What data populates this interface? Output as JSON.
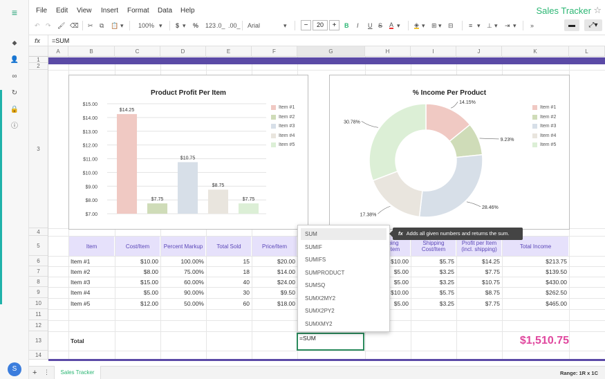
{
  "menu": [
    "File",
    "Edit",
    "View",
    "Insert",
    "Format",
    "Data",
    "Help"
  ],
  "app_title": "Sales Tracker",
  "toolbar": {
    "zoom": "100%",
    "currency": "$",
    "percent": "%",
    "more_formats": "123",
    "dec_dec": ".0_",
    "inc_dec": ".00_",
    "font": "Arial",
    "font_size": "20",
    "minus": "−",
    "plus": "+",
    "bold": "B",
    "italic": "I",
    "underline": "U",
    "strike": "S",
    "text_color": "A"
  },
  "formula_bar": {
    "fx": "fx",
    "value": "=SUM"
  },
  "columns": [
    "A",
    "B",
    "C",
    "D",
    "E",
    "F",
    "G",
    "H",
    "I",
    "J",
    "K",
    "L"
  ],
  "rows": [
    "1",
    "2",
    "3",
    "4",
    "5",
    "6",
    "7",
    "8",
    "9",
    "10",
    "11",
    "12",
    "13",
    "14"
  ],
  "table": {
    "headers": [
      "Item",
      "Cost/Item",
      "Percent Markup",
      "Total Sold",
      "Price/Item",
      "",
      "Shipping Cost/Item",
      "Shipping Cost/Item",
      "Profit per Item (incl. shipping)",
      "Total Income"
    ],
    "header_h_partial": "ping\n/Item",
    "rows": [
      [
        "Item #1",
        "$10.00",
        "100.00%",
        "15",
        "$20.00",
        "",
        "$10.00",
        "$5.75",
        "$14.25",
        "$213.75"
      ],
      [
        "Item #2",
        "$8.00",
        "75.00%",
        "18",
        "$14.00",
        "",
        "$5.00",
        "$3.25",
        "$7.75",
        "$139.50"
      ],
      [
        "Item #3",
        "$15.00",
        "60.00%",
        "40",
        "$24.00",
        "",
        "$5.00",
        "$3.25",
        "$10.75",
        "$430.00"
      ],
      [
        "Item #4",
        "$5.00",
        "90.00%",
        "30",
        "$9.50",
        "",
        "$10.00",
        "$5.75",
        "$8.75",
        "$262.50"
      ],
      [
        "Item #5",
        "$12.00",
        "50.00%",
        "60",
        "$18.00",
        "",
        "$5.00",
        "$3.25",
        "$7.75",
        "$465.00"
      ]
    ],
    "total_label": "Total",
    "total_value": "$1,510.75"
  },
  "edit_cell": "=SUM",
  "autocomplete": [
    "SUM",
    "SUMIF",
    "SUMIFS",
    "SUMPRODUCT",
    "SUMSQ",
    "SUMX2MY2",
    "SUMX2PY2",
    "SUMXMY2"
  ],
  "tooltip": {
    "fx": "fx",
    "text": "Adds all given numbers and returns the sum."
  },
  "sheet_tab": "Sales Tracker",
  "add_sheet": "+",
  "sheet_menu": "⋮",
  "range_label": "Range: 1R x 1C",
  "colors": {
    "accent": "#2bb673",
    "band": "#5b4aa6",
    "header_bg": "#e6e1fb",
    "total": "#e0479e",
    "item1": "#f0c9c3",
    "item2": "#cfdcb8",
    "item3": "#d7dfe8",
    "item4": "#e9e5de",
    "item5": "#dcefd6"
  },
  "chart_data": [
    {
      "type": "bar",
      "title": "Product Profit Per Item",
      "categories": [
        "Item #1",
        "Item #2",
        "Item #3",
        "Item #4",
        "Item #5"
      ],
      "values": [
        14.25,
        7.75,
        10.75,
        8.75,
        7.75
      ],
      "data_labels": [
        "$14.25",
        "$7.75",
        "$10.75",
        "$8.75",
        "$7.75"
      ],
      "ylim": [
        7,
        15
      ],
      "yticks": [
        "$15.00",
        "$14.00",
        "$13.00",
        "$12.00",
        "$11.00",
        "$10.00",
        "$9.00",
        "$8.00",
        "$7.00"
      ],
      "legend": [
        "Item #1",
        "Item #2",
        "Item #3",
        "Item #4",
        "Item #5"
      ],
      "legend_position": "right",
      "grid": true
    },
    {
      "type": "pie",
      "title": "% Income Per Product",
      "categories": [
        "Item #1",
        "Item #2",
        "Item #3",
        "Item #4",
        "Item #5"
      ],
      "values": [
        14.15,
        9.23,
        28.46,
        17.38,
        30.78
      ],
      "data_labels": [
        "14.15%",
        "9.23%",
        "28.46%",
        "17.38%",
        "30.78%"
      ],
      "legend": [
        "Item #1",
        "Item #2",
        "Item #3",
        "Item #4",
        "Item #5"
      ],
      "legend_position": "right",
      "donut": true
    }
  ]
}
